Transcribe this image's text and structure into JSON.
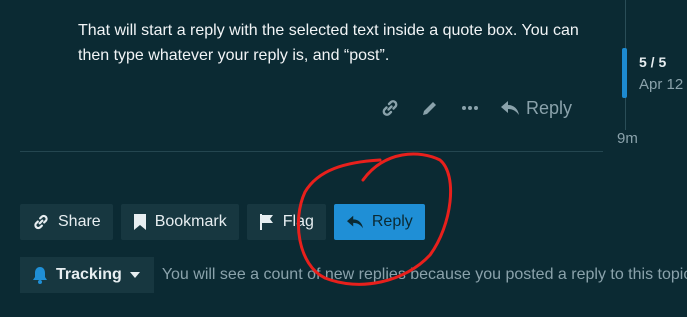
{
  "post": {
    "text": "That will start a reply with the selected text inside a quote box. You can then type whatever your reply is, and “post”.",
    "actions": {
      "link_icon": "link-icon",
      "edit_icon": "pencil-icon",
      "more_icon": "ellipsis-icon",
      "reply_label": "Reply"
    }
  },
  "timeline": {
    "position": "5 / 5",
    "date": "Apr 12",
    "age": "9m"
  },
  "footer": {
    "share_label": "Share",
    "bookmark_label": "Bookmark",
    "flag_label": "Flag",
    "reply_label": "Reply"
  },
  "tracking": {
    "label": "Tracking",
    "description": "You will see a count of new replies because you posted a reply to this topic."
  },
  "colors": {
    "background": "#0b2a33",
    "button_bg": "#173740",
    "primary": "#1f8fd6",
    "muted_text": "#8aa2ab",
    "annotation": "#e8201c"
  }
}
